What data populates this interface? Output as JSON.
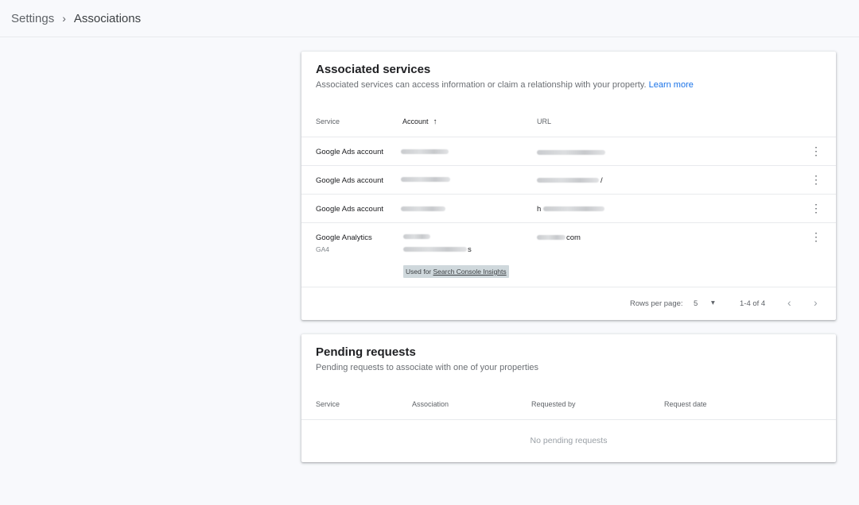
{
  "breadcrumb": {
    "parent": "Settings",
    "separator": "›",
    "current": "Associations"
  },
  "associated": {
    "title": "Associated services",
    "subtitle": "Associated services can access information or claim a relationship with your property.",
    "learn_more": "Learn more",
    "headers": {
      "service": "Service",
      "account": "Account",
      "url": "URL"
    },
    "sort_icon": "arrow-up-icon",
    "rows": [
      {
        "service": "Google Ads account",
        "url_suffix": ""
      },
      {
        "service": "Google Ads account",
        "url_suffix": "/"
      },
      {
        "service": "Google Ads account",
        "url_prefix": "h"
      },
      {
        "service": "Google Analytics",
        "service_sub": "GA4",
        "account_tail": "s",
        "url_tail": "com",
        "chip_prefix": "Used for",
        "chip_link": "Search Console Insights"
      }
    ],
    "kebab": "⋮",
    "pagination": {
      "rows_per_page_label": "Rows per page:",
      "rows_per_page": "5",
      "dropdown_icon": "▾",
      "range": "1-4 of 4",
      "prev": "‹",
      "next": "›"
    }
  },
  "pending": {
    "title": "Pending requests",
    "subtitle": "Pending requests to associate with one of your properties",
    "headers": {
      "service": "Service",
      "association": "Association",
      "requested_by": "Requested by",
      "request_date": "Request date"
    },
    "empty": "No pending requests"
  }
}
